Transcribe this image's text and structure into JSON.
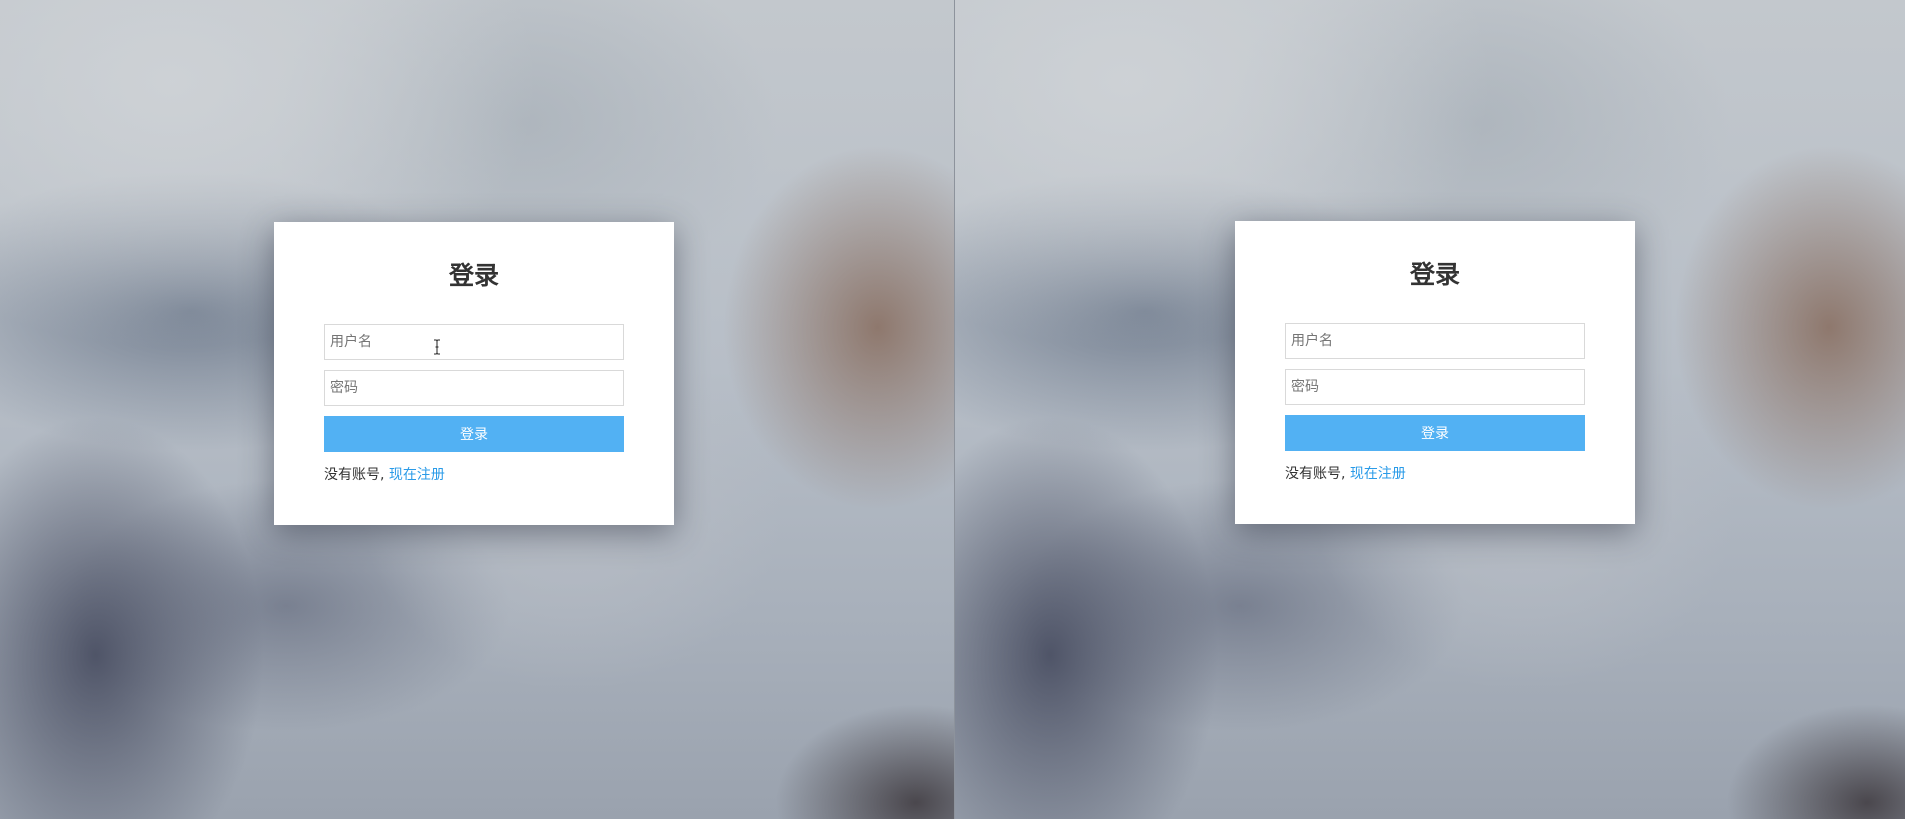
{
  "left_pane": {
    "login_card": {
      "title": "登录",
      "username_placeholder": "用户名",
      "password_placeholder": "密码",
      "login_button_label": "登录",
      "no_account_text": "没有账号, ",
      "register_link_label": "现在注册"
    },
    "cursor": "text-cursor-icon"
  },
  "right_pane": {
    "login_card": {
      "title": "登录",
      "username_placeholder": "用户名",
      "password_placeholder": "密码",
      "login_button_label": "登录",
      "no_account_text": "没有账号, ",
      "register_link_label": "现在注册"
    }
  },
  "colors": {
    "primary_button": "#52b1f3",
    "link": "#2a9be8",
    "title_text": "#333333",
    "card_background": "#ffffff"
  }
}
